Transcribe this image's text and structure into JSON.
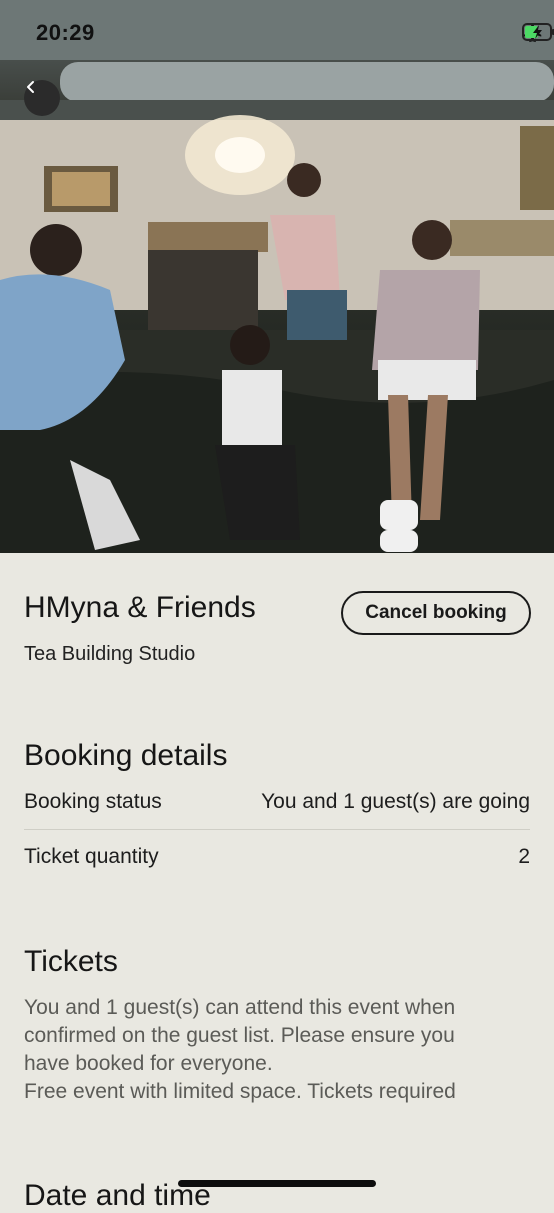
{
  "status_bar": {
    "time": "20:29",
    "icons": [
      "airplane-icon",
      "battery-charging-icon"
    ]
  },
  "hero": {
    "image_description_icon": "event-photo"
  },
  "nav": {
    "back_icon": "chevron-left-icon"
  },
  "event": {
    "title": "HMyna & Friends",
    "venue": "Tea Building Studio",
    "cancel_label": "Cancel booking"
  },
  "booking_details": {
    "heading": "Booking details",
    "rows": [
      {
        "label": "Booking status",
        "value": "You and 1 guest(s) are going"
      },
      {
        "label": "Ticket quantity",
        "value": "2"
      }
    ]
  },
  "tickets": {
    "heading": "Tickets",
    "lines": [
      "You and 1 guest(s) can attend this event when",
      "confirmed on the guest list. Please ensure you",
      "have booked for everyone.",
      "Free event with limited space. Tickets required"
    ]
  },
  "date_time": {
    "heading": "Date and time"
  },
  "colors": {
    "background": "#e9e8e1",
    "text": "#1a1a1a",
    "muted_text": "#5b5b57",
    "back_button": "#2b2b2b"
  }
}
